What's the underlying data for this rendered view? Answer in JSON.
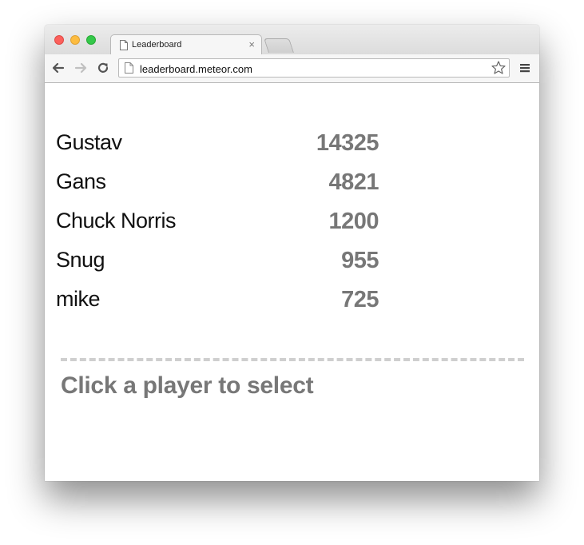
{
  "browser": {
    "tab_title": "Leaderboard",
    "tab_close": "×",
    "url": "leaderboard.meteor.com"
  },
  "leaderboard": {
    "players": [
      {
        "name": "Gustav",
        "score": "14325"
      },
      {
        "name": "Gans",
        "score": "4821"
      },
      {
        "name": "Chuck Norris",
        "score": "1200"
      },
      {
        "name": "Snug",
        "score": "955"
      },
      {
        "name": "mike",
        "score": "725"
      }
    ],
    "prompt": "Click a player to select"
  },
  "icons": {
    "back": "back-arrow-icon",
    "forward": "forward-arrow-icon",
    "reload": "reload-icon",
    "page": "page-icon",
    "bookmark": "star-icon",
    "menu": "hamburger-menu-icon"
  }
}
